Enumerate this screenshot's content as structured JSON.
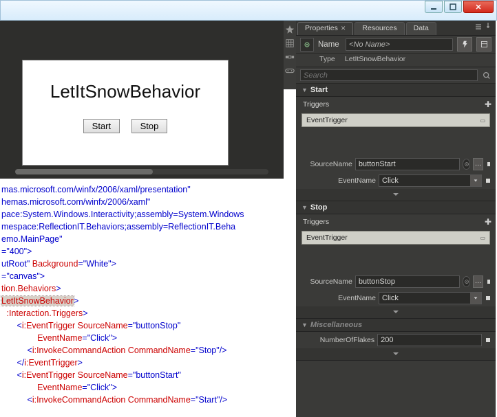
{
  "titlebar": {},
  "artboard": {
    "title": "LetItSnowBehavior",
    "start_btn": "Start",
    "stop_btn": "Stop"
  },
  "code": {
    "l1_url": "mas.microsoft.com/winfx/2006/xaml/presentation\"",
    "l2_url": "hemas.microsoft.com/winfx/2006/xaml\"",
    "l3": "pace:System.Windows.Interactivity;assembly=System.Windows",
    "l4": "mespace:ReflectionIT.Behaviors;assembly=ReflectionIT.Beha",
    "l5": "emo.MainPage\"",
    "l6a": "=",
    "l6b": "\"400\"",
    "l7a": "utRoot\"",
    "l7b": " Background",
    "l7c": "=",
    "l7d": "\"White\"",
    "l8a": "=",
    "l8b": "\"canvas\"",
    "l9": "tion.Behaviors",
    "l10": "LetItSnowBehavior",
    "l11": ":Interaction.Triggers",
    "l12a": "i:EventTrigger",
    "l12b": " SourceName",
    "l12c": "\"buttonStop\"",
    "l13a": "               EventName",
    "l13b": "\"Click\"",
    "l14a": "i:InvokeCommandAction",
    "l14b": " CommandName",
    "l14c": "\"Stop\"",
    "l15": "i:EventTrigger",
    "l16c": "\"buttonStart\"",
    "l18c": "\"Start\""
  },
  "panel": {
    "tabs": {
      "properties": "Properties",
      "resources": "Resources",
      "data": "Data"
    },
    "name_label": "Name",
    "name_value": "<No Name>",
    "type_label": "Type",
    "type_value": "LetItSnowBehavior",
    "search_placeholder": "Search",
    "sections": {
      "start": {
        "title": "Start",
        "triggers_label": "Triggers",
        "trigger_item": "EventTrigger",
        "source_name_label": "SourceName",
        "source_name_value": "buttonStart",
        "event_name_label": "EventName",
        "event_name_value": "Click"
      },
      "stop": {
        "title": "Stop",
        "triggers_label": "Triggers",
        "trigger_item": "EventTrigger",
        "source_name_label": "SourceName",
        "source_name_value": "buttonStop",
        "event_name_label": "EventName",
        "event_name_value": "Click"
      },
      "misc": {
        "title": "Miscellaneous",
        "flakes_label": "NumberOfFlakes",
        "flakes_value": "200"
      }
    }
  }
}
